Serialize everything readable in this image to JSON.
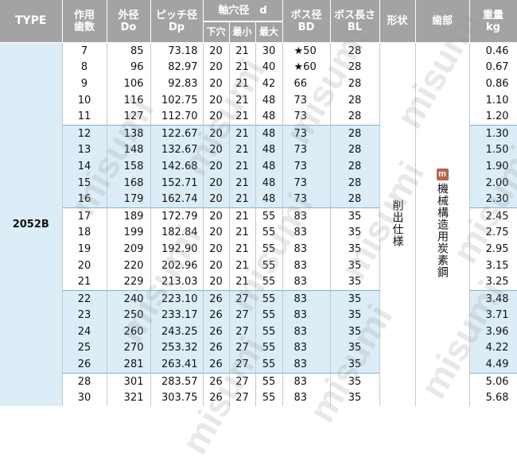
{
  "headers": {
    "type": "TYPE",
    "teeth": [
      "作用",
      "歯数"
    ],
    "do": [
      "外径",
      "Do"
    ],
    "dp": [
      "ピッチ径",
      "Dp"
    ],
    "bore": "軸穴径　d",
    "bore_sub": [
      "下穴",
      "最小",
      "最大"
    ],
    "bd": [
      "ボス径",
      "BD"
    ],
    "bl": [
      "ボス長さ",
      "BL"
    ],
    "shape": "形状",
    "tooth": "歯部",
    "weight": [
      "重量",
      "kg"
    ]
  },
  "type_label": "2052B",
  "shape_text": "削出仕様",
  "tooth_badge": "m",
  "tooth_text": "機械構造用炭素鋼",
  "watermark_text": "misumi",
  "colors": {
    "header_bg": "#a3a3a3",
    "band_blue": "#dcedf8",
    "badge": "#b5654a"
  },
  "rows": [
    {
      "n": "7",
      "do": "85",
      "dp": "73.18",
      "pilot": "20",
      "min": "21",
      "max": "30",
      "bd": "★50",
      "bl": "28",
      "w": "0.46"
    },
    {
      "n": "8",
      "do": "96",
      "dp": "82.97",
      "pilot": "20",
      "min": "21",
      "max": "40",
      "bd": "★60",
      "bl": "28",
      "w": "0.67"
    },
    {
      "n": "9",
      "do": "106",
      "dp": "92.83",
      "pilot": "20",
      "min": "21",
      "max": "42",
      "bd": "66",
      "bl": "28",
      "w": "0.86"
    },
    {
      "n": "10",
      "do": "116",
      "dp": "102.75",
      "pilot": "20",
      "min": "21",
      "max": "48",
      "bd": "73",
      "bl": "28",
      "w": "1.10"
    },
    {
      "n": "11",
      "do": "127",
      "dp": "112.70",
      "pilot": "20",
      "min": "21",
      "max": "48",
      "bd": "73",
      "bl": "28",
      "w": "1.20"
    },
    {
      "n": "12",
      "do": "138",
      "dp": "122.67",
      "pilot": "20",
      "min": "21",
      "max": "48",
      "bd": "73",
      "bl": "28",
      "w": "1.30"
    },
    {
      "n": "13",
      "do": "148",
      "dp": "132.67",
      "pilot": "20",
      "min": "21",
      "max": "48",
      "bd": "73",
      "bl": "28",
      "w": "1.50"
    },
    {
      "n": "14",
      "do": "158",
      "dp": "142.68",
      "pilot": "20",
      "min": "21",
      "max": "48",
      "bd": "73",
      "bl": "28",
      "w": "1.90"
    },
    {
      "n": "15",
      "do": "168",
      "dp": "152.71",
      "pilot": "20",
      "min": "21",
      "max": "48",
      "bd": "73",
      "bl": "28",
      "w": "2.00"
    },
    {
      "n": "16",
      "do": "179",
      "dp": "162.74",
      "pilot": "20",
      "min": "21",
      "max": "48",
      "bd": "73",
      "bl": "28",
      "w": "2.30"
    },
    {
      "n": "17",
      "do": "189",
      "dp": "172.79",
      "pilot": "20",
      "min": "21",
      "max": "55",
      "bd": "83",
      "bl": "35",
      "w": "2.45"
    },
    {
      "n": "18",
      "do": "199",
      "dp": "182.84",
      "pilot": "20",
      "min": "21",
      "max": "55",
      "bd": "83",
      "bl": "35",
      "w": "2.75"
    },
    {
      "n": "19",
      "do": "209",
      "dp": "192.90",
      "pilot": "20",
      "min": "21",
      "max": "55",
      "bd": "83",
      "bl": "35",
      "w": "2.95"
    },
    {
      "n": "20",
      "do": "220",
      "dp": "202.96",
      "pilot": "20",
      "min": "21",
      "max": "55",
      "bd": "83",
      "bl": "35",
      "w": "3.15"
    },
    {
      "n": "21",
      "do": "229",
      "dp": "213.03",
      "pilot": "20",
      "min": "21",
      "max": "55",
      "bd": "83",
      "bl": "35",
      "w": "3.25"
    },
    {
      "n": "22",
      "do": "240",
      "dp": "223.10",
      "pilot": "26",
      "min": "27",
      "max": "55",
      "bd": "83",
      "bl": "35",
      "w": "3.48"
    },
    {
      "n": "23",
      "do": "250",
      "dp": "233.17",
      "pilot": "26",
      "min": "27",
      "max": "55",
      "bd": "83",
      "bl": "35",
      "w": "3.71"
    },
    {
      "n": "24",
      "do": "260",
      "dp": "243.25",
      "pilot": "26",
      "min": "27",
      "max": "55",
      "bd": "83",
      "bl": "35",
      "w": "3.96"
    },
    {
      "n": "25",
      "do": "270",
      "dp": "253.32",
      "pilot": "26",
      "min": "27",
      "max": "55",
      "bd": "83",
      "bl": "35",
      "w": "4.22"
    },
    {
      "n": "26",
      "do": "281",
      "dp": "263.41",
      "pilot": "26",
      "min": "27",
      "max": "55",
      "bd": "83",
      "bl": "35",
      "w": "4.49"
    },
    {
      "n": "28",
      "do": "301",
      "dp": "283.57",
      "pilot": "26",
      "min": "27",
      "max": "55",
      "bd": "83",
      "bl": "35",
      "w": "5.06"
    },
    {
      "n": "30",
      "do": "321",
      "dp": "303.75",
      "pilot": "26",
      "min": "27",
      "max": "55",
      "bd": "83",
      "bl": "35",
      "w": "5.68"
    }
  ]
}
